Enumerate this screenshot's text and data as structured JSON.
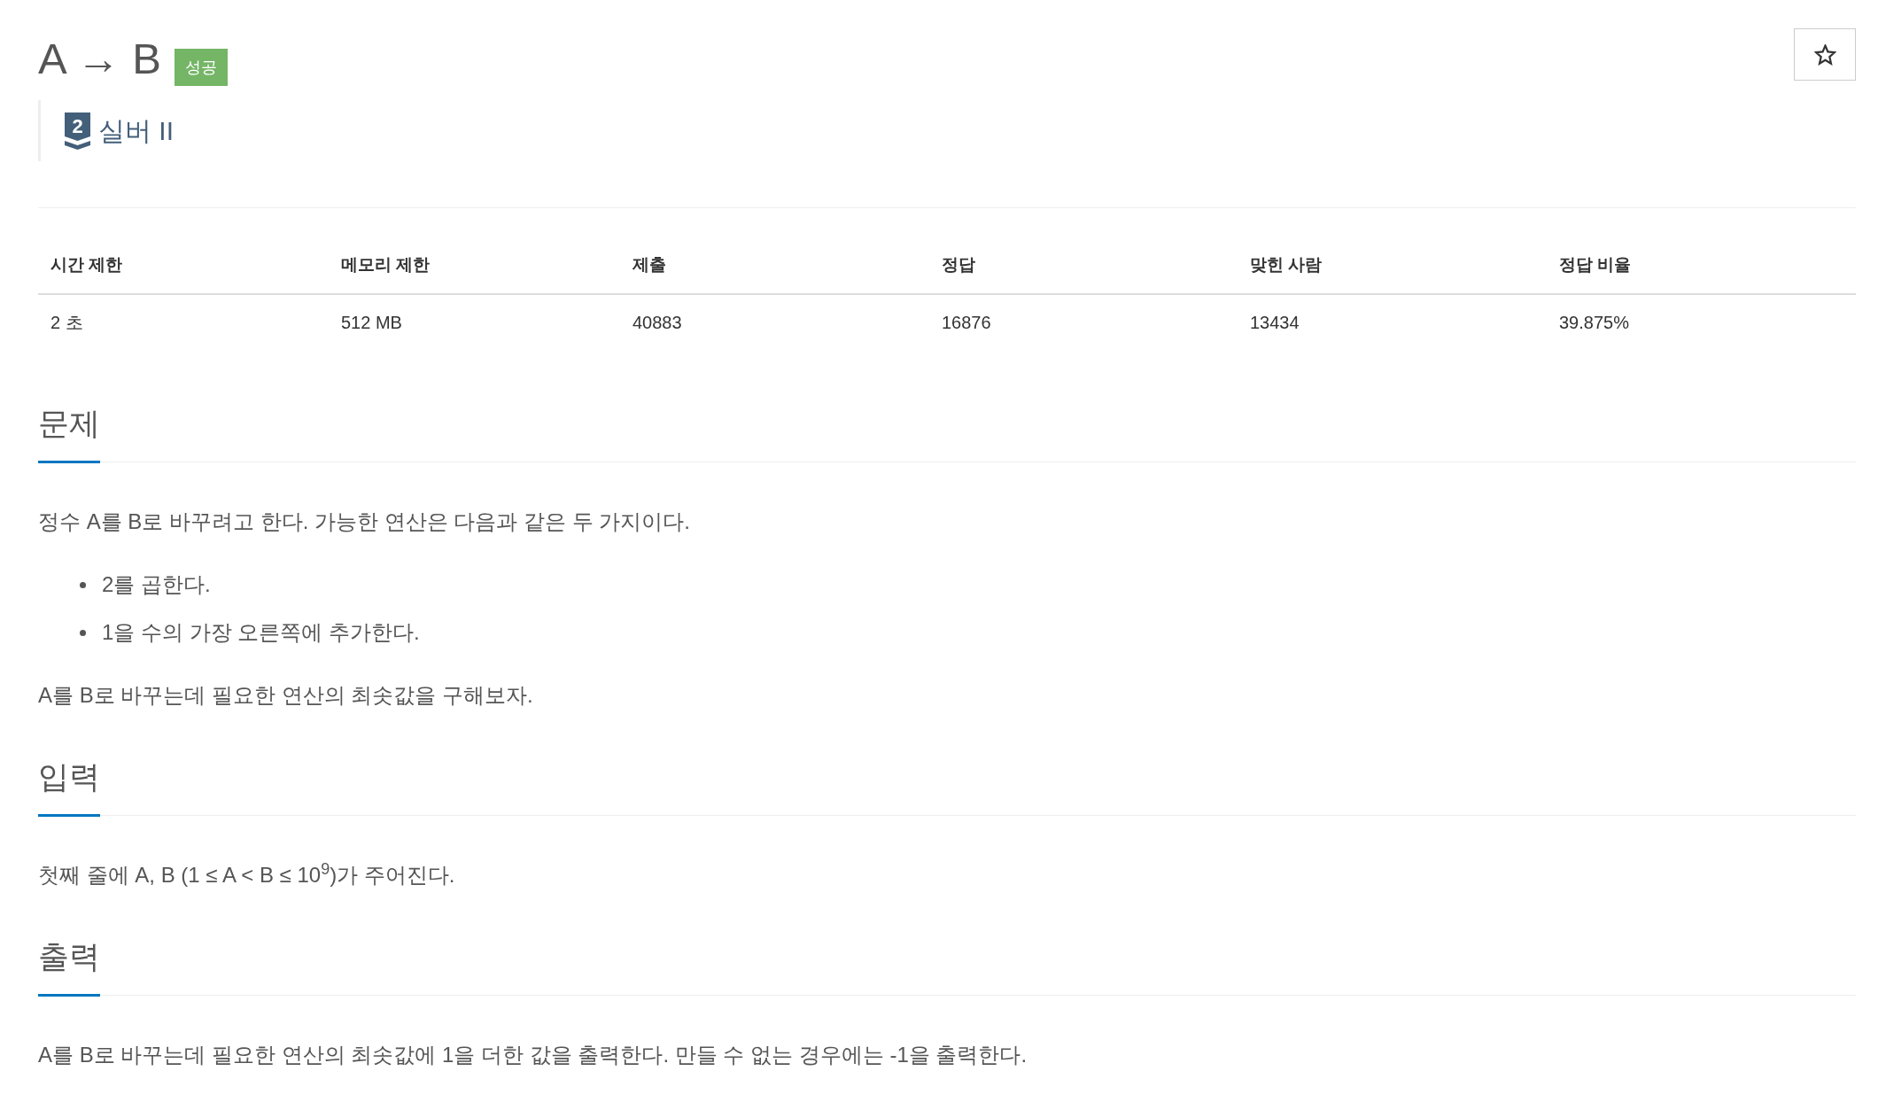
{
  "problem": {
    "title": "A → B",
    "result_label": "성공",
    "favorite": {
      "starred": false
    },
    "tier": {
      "badge_number": "2",
      "name": "실버 II"
    }
  },
  "stats": {
    "columns": [
      "시간 제한",
      "메모리 제한",
      "제출",
      "정답",
      "맞힌 사람",
      "정답 비율"
    ],
    "rows": [
      [
        "2 초",
        "512 MB",
        "40883",
        "16876",
        "13434",
        "39.875%"
      ]
    ]
  },
  "sections": [
    {
      "heading": "문제",
      "content": [
        {
          "kind": "paragraph",
          "text": "정수 A를 B로 바꾸려고 한다. 가능한 연산은 다음과 같은 두 가지이다."
        },
        {
          "kind": "list",
          "items": [
            "2를 곱한다.",
            "1을 수의 가장 오른쪽에 추가한다."
          ]
        },
        {
          "kind": "paragraph",
          "text": "A를 B로 바꾸는데 필요한 연산의 최솟값을 구해보자."
        }
      ]
    },
    {
      "heading": "입력",
      "content": [
        {
          "kind": "paragraph",
          "text": "첫째 줄에 A, B (1 ≤ A < B ≤ 10$^{9}$)가 주어진다."
        }
      ]
    },
    {
      "heading": "출력",
      "content": [
        {
          "kind": "paragraph",
          "text": "A를 B로 바꾸는데 필요한 연산의 최솟값에 1을 더한 값을 출력한다. 만들 수 없는 경우에는 -1을 출력한다."
        }
      ]
    }
  ]
}
